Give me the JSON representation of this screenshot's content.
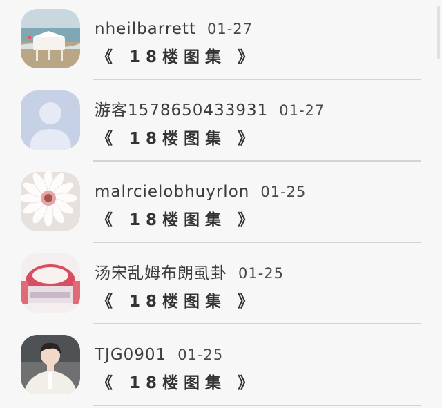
{
  "comments": [
    {
      "username": "nheilbarrett",
      "date": "01-27",
      "link_text": "《 18楼图集 》",
      "avatar": "piano-on-beach-avatar"
    },
    {
      "username": "游客1578650433931",
      "date": "01-27",
      "link_text": "《 18楼图集 》",
      "avatar": "default-guest-avatar"
    },
    {
      "username": "malrcielobhuyrlon",
      "date": "01-25",
      "link_text": "《 18楼图集 》",
      "avatar": "gerbera-flower-avatar"
    },
    {
      "username": "汤宋乱姆布朗虱卦",
      "date": "01-25",
      "link_text": "《 18楼图集 》",
      "avatar": "pink-cake-avatar"
    },
    {
      "username": "TJG0901",
      "date": "01-25",
      "link_text": "《 18楼图集 》",
      "avatar": "person-photo-avatar"
    }
  ]
}
